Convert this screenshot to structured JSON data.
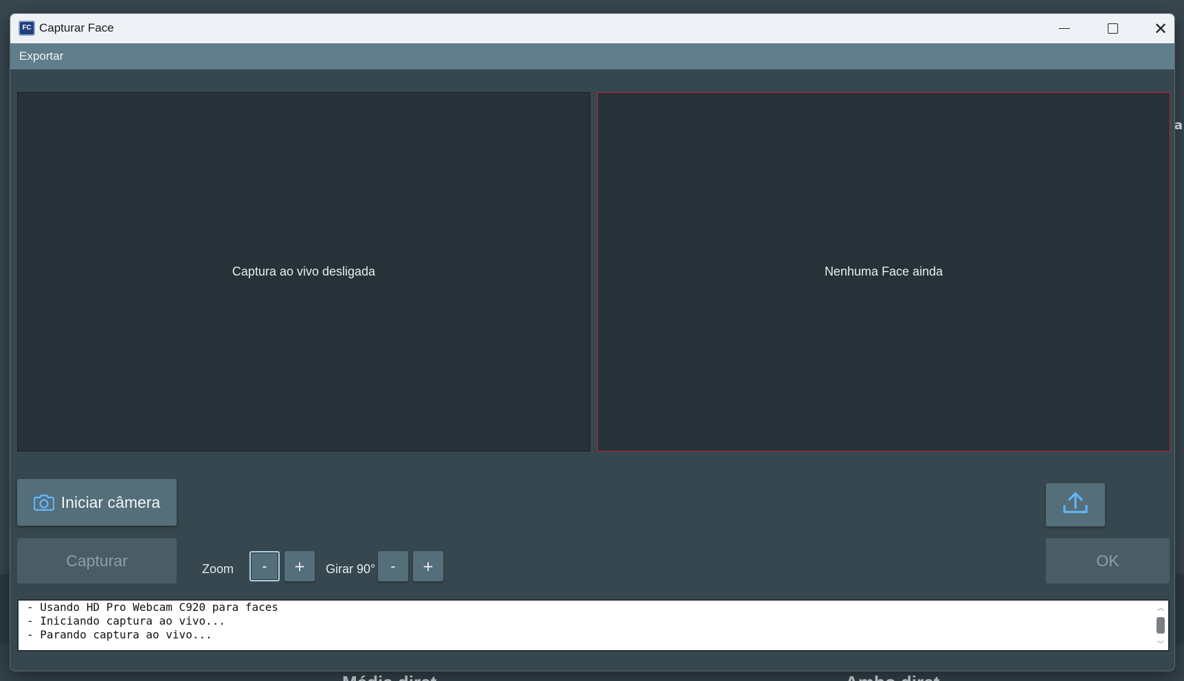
{
  "window": {
    "title": "Capturar Face",
    "app_icon_text": "FC"
  },
  "menu": {
    "items": [
      "Exportar"
    ]
  },
  "panels": {
    "live_text": "Captura ao vivo desligada",
    "face_text": "Nenhuma Face ainda"
  },
  "controls": {
    "start_camera_label": "Iniciar câmera",
    "capture_label": "Capturar",
    "ok_label": "OK",
    "zoom_label": "Zoom",
    "rotate_label": "Girar 90°",
    "minus": "-",
    "plus": "+"
  },
  "log": {
    "lines": [
      "- Usando HD Pro Webcam C920 para faces",
      "- Iniciando captura ao vivo...",
      "- Parando captura ao vivo..."
    ]
  },
  "background": {
    "letter": "a",
    "text_left": "Média diret",
    "text_right": "Ambo diret"
  },
  "colors": {
    "accent_border": "#c62828",
    "button": "#546e7a",
    "menubar": "#607d8b",
    "panel": "#263238"
  }
}
